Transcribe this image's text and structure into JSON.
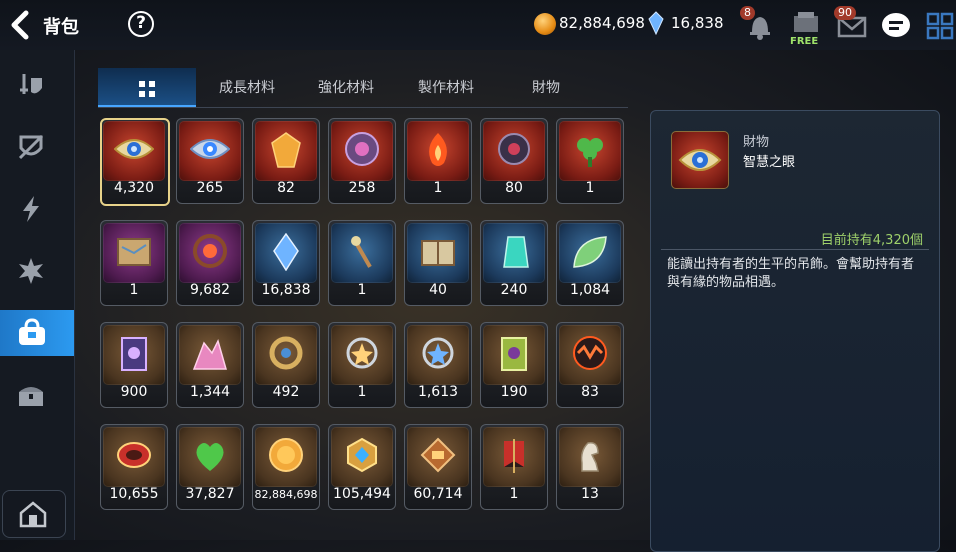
{
  "header": {
    "title": "背包"
  },
  "currency": {
    "gold": "82,884,698",
    "crystal": "16,838"
  },
  "notifications": {
    "bell_count": "8",
    "mail_count": "90",
    "free_label": "FREE"
  },
  "tabs": [
    {
      "label": "",
      "icon": "grid-icon",
      "active": true
    },
    {
      "label": "成長材料"
    },
    {
      "label": "強化材料"
    },
    {
      "label": "製作材料"
    },
    {
      "label": "財物"
    }
  ],
  "items": [
    {
      "count": "4,320",
      "bg": "red",
      "icon": "eye-amulet"
    },
    {
      "count": "265",
      "bg": "red",
      "icon": "eye-amulet-blue"
    },
    {
      "count": "82",
      "bg": "red",
      "icon": "gold-crystal"
    },
    {
      "count": "258",
      "bg": "red",
      "icon": "purple-disc"
    },
    {
      "count": "1",
      "bg": "red",
      "icon": "flame-pendant"
    },
    {
      "count": "80",
      "bg": "red",
      "icon": "dark-pendant"
    },
    {
      "count": "1",
      "bg": "red",
      "icon": "clover-pendant"
    },
    {
      "count": "1",
      "bg": "purple",
      "icon": "map-scroll"
    },
    {
      "count": "9,682",
      "bg": "purple",
      "icon": "flower-brooch"
    },
    {
      "count": "16,838",
      "bg": "blue",
      "icon": "blue-crystal"
    },
    {
      "count": "1",
      "bg": "blue",
      "icon": "wand"
    },
    {
      "count": "40",
      "bg": "blue",
      "icon": "book"
    },
    {
      "count": "240",
      "bg": "blue",
      "icon": "teal-gem"
    },
    {
      "count": "1,084",
      "bg": "blue",
      "icon": "leaf"
    },
    {
      "count": "900",
      "bg": "brown",
      "icon": "card"
    },
    {
      "count": "1,344",
      "bg": "brown",
      "icon": "pink-ore"
    },
    {
      "count": "492",
      "bg": "brown",
      "icon": "gold-ring"
    },
    {
      "count": "1",
      "bg": "brown",
      "icon": "star-pendant"
    },
    {
      "count": "1,613",
      "bg": "brown",
      "icon": "blue-star-pendant"
    },
    {
      "count": "190",
      "bg": "brown",
      "icon": "green-card"
    },
    {
      "count": "83",
      "bg": "brown",
      "icon": "fire-orb"
    },
    {
      "count": "10,655",
      "bg": "brown",
      "icon": "red-bracelet"
    },
    {
      "count": "37,827",
      "bg": "brown",
      "icon": "green-heart"
    },
    {
      "count": "82,884,698",
      "bg": "brown",
      "icon": "gold-coin"
    },
    {
      "count": "105,494",
      "bg": "brown",
      "icon": "gold-medal"
    },
    {
      "count": "60,714",
      "bg": "brown",
      "icon": "bronze-medal"
    },
    {
      "count": "1",
      "bg": "brown",
      "icon": "banner"
    },
    {
      "count": "13",
      "bg": "brown",
      "icon": "chess-knight"
    }
  ],
  "detail": {
    "category": "財物",
    "name": "智慧之眼",
    "owned": "目前持有4,320個",
    "description": "能讀出持有者的生平的吊飾。會幫助持有者與有緣的物品相遇。"
  },
  "colors": {
    "accent": "#2c9af0",
    "owned_text": "#9ed06a",
    "selected_border": "#e7d28a"
  }
}
